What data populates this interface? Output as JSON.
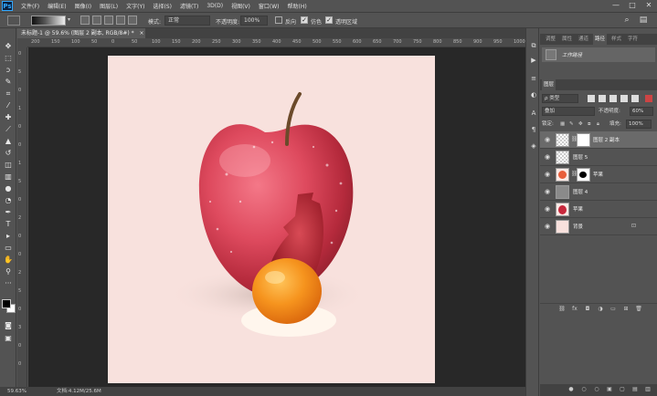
{
  "app": {
    "logo": "Ps"
  },
  "menu": [
    "文件(F)",
    "编辑(E)",
    "图像(I)",
    "图层(L)",
    "文字(Y)",
    "选择(S)",
    "滤镜(T)",
    "3D(D)",
    "视图(V)",
    "窗口(W)",
    "帮助(H)"
  ],
  "window_controls": [
    "—",
    "□",
    "✕"
  ],
  "options": {
    "mode_label": "模式:",
    "mode_value": "正常",
    "opacity_label": "不透明度:",
    "opacity_value": "100%",
    "reverse_label": "反向",
    "reverse_checked": false,
    "dither_label": "仿色",
    "dither_checked": true,
    "transparency_label": "透明区域",
    "transparency_checked": true
  },
  "document": {
    "tab_title": "未标题-1 @ 59.6% (图层 2 副本, RGB/8#) *",
    "close": "×",
    "canvas_bg": "#f8e1dd"
  },
  "ruler_h": [
    "200",
    "150",
    "100",
    "50",
    "0",
    "50",
    "100",
    "150",
    "200",
    "250",
    "300",
    "350",
    "400",
    "450",
    "500",
    "550",
    "600",
    "650",
    "700",
    "750",
    "800",
    "850",
    "900",
    "950",
    "1000"
  ],
  "ruler_v": [
    "0",
    "5",
    "0",
    "1",
    "0",
    "0",
    "1",
    "5",
    "0",
    "2",
    "0",
    "0",
    "2",
    "5",
    "0",
    "3",
    "0",
    "0"
  ],
  "status": {
    "zoom": "59.63%",
    "doc": "文档:4.12M/25.6M"
  },
  "top_panel": {
    "tabs": [
      "调整",
      "属性",
      "通道",
      "路径",
      "样式",
      "字符"
    ],
    "active_tab": "路径",
    "path_item": "工作路径"
  },
  "layers_panel": {
    "tab": "图层",
    "kind_label": "ρ 类型",
    "blend_mode": "叠加",
    "opacity_label": "不透明度:",
    "opacity_value": "60%",
    "lock_label": "锁定:",
    "fill_label": "填充:",
    "fill_value": "100%",
    "layers": [
      {
        "name": "图层 2 副本",
        "selected": true
      },
      {
        "name": "图层 5",
        "selected": false
      },
      {
        "name": "苹果",
        "selected": false
      },
      {
        "name": "图层 4",
        "selected": false
      },
      {
        "name": "苹果",
        "selected": false
      },
      {
        "name": "背景",
        "selected": false
      }
    ],
    "footer_icons": [
      "link-icon",
      "fx-icon",
      "mask-icon",
      "adjustment-icon",
      "group-icon",
      "new-layer-icon",
      "trash-icon"
    ]
  }
}
